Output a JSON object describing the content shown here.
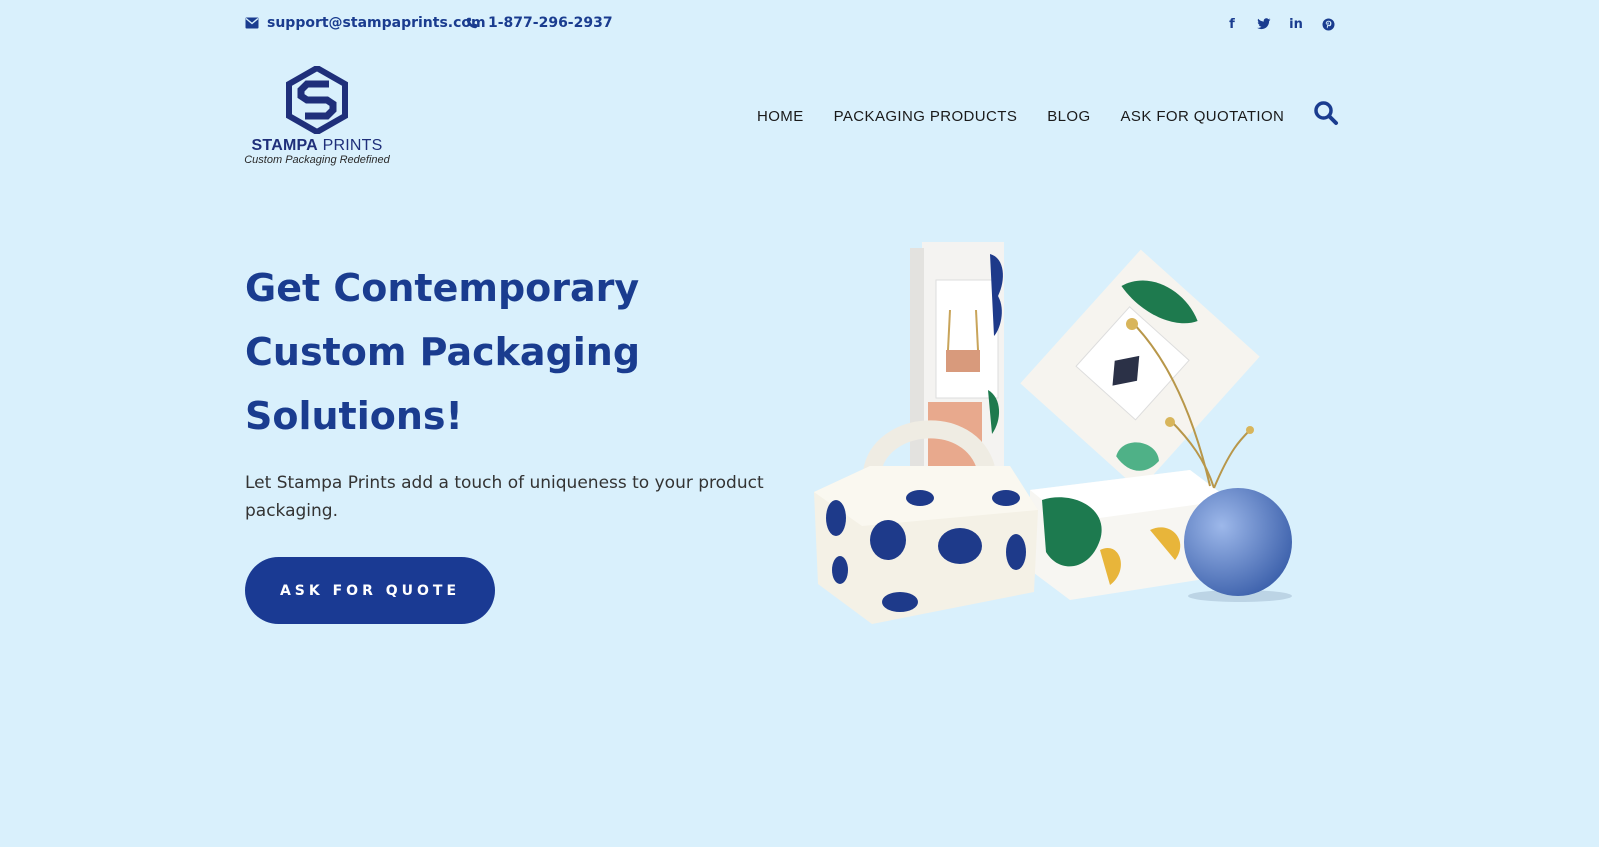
{
  "topbar": {
    "email": "support@stampaprints.com",
    "phone": "1-877-296-2937",
    "social": [
      {
        "name": "facebook",
        "glyph": "f"
      },
      {
        "name": "twitter",
        "glyph": "t"
      },
      {
        "name": "linkedin",
        "glyph": "in"
      },
      {
        "name": "pinterest",
        "glyph": "p"
      }
    ]
  },
  "logo": {
    "name_bold": "STAMPA",
    "name_regular": " PRINTS",
    "tagline": "Custom Packaging Redefined"
  },
  "nav": {
    "items": [
      "HOME",
      "PACKAGING PRODUCTS",
      "BLOG",
      "ASK FOR QUOTATION"
    ]
  },
  "hero": {
    "title_line1": "Get Contemporary",
    "title_line2": "Custom Packaging",
    "title_line3": "Solutions!",
    "subtitle": "Let Stampa Prints add a touch of uniqueness to your product packaging.",
    "cta_label": "ASK FOR QUOTE"
  },
  "colors": {
    "background": "#d9f0fc",
    "brand": "#1a3c8f",
    "button": "#1a3a93"
  },
  "icons": [
    "envelope-icon",
    "phone-icon",
    "facebook-icon",
    "twitter-icon",
    "linkedin-icon",
    "pinterest-icon",
    "search-icon"
  ]
}
